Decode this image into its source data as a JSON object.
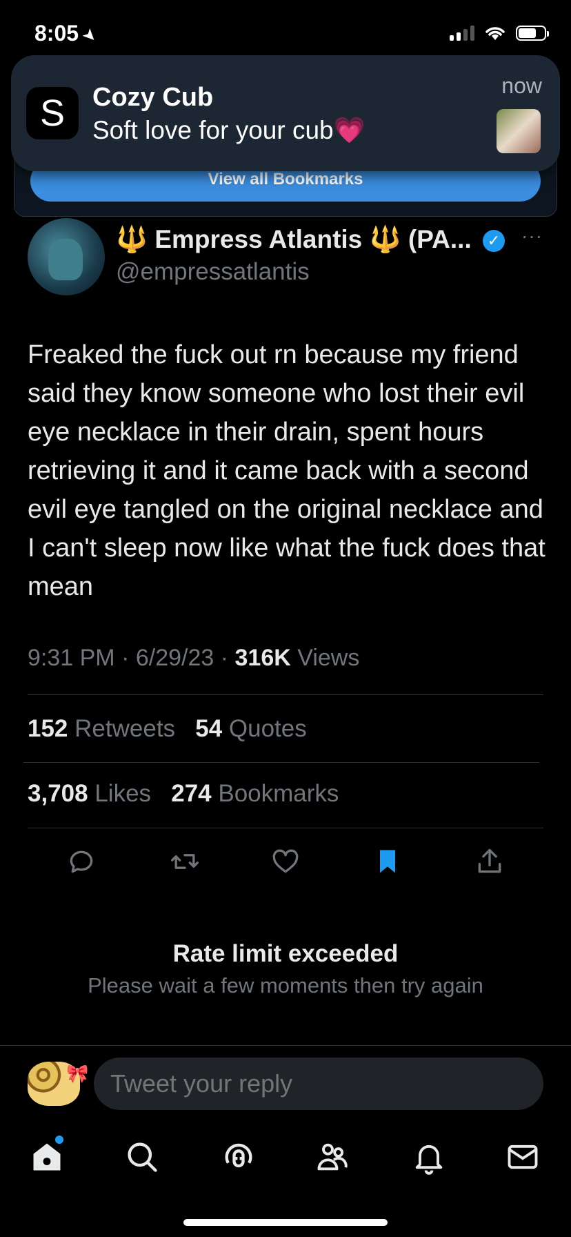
{
  "status_bar": {
    "time": "8:05",
    "location_icon": "location-arrow-icon"
  },
  "notification": {
    "app_icon_letter": "S",
    "title": "Cozy Cub",
    "body": "Soft love for your cub💗",
    "time": "now"
  },
  "bookmark_banner": {
    "button_label": "View all Bookmarks"
  },
  "tweet": {
    "author_name": "Empress Atlantis",
    "name_suffix": "(PA...",
    "trident": "🔱",
    "handle": "@empressatlantis",
    "more": "···",
    "text": "Freaked the fuck out rn because my friend said they know someone who lost their evil eye necklace in their drain, spent hours retrieving it and it came back with a second evil eye tangled on the original necklace and I can't sleep now like what the fuck does that mean",
    "time": "9:31 PM",
    "date": "6/29/23",
    "views_count": "316K",
    "views_label": "Views",
    "stats": {
      "retweets_count": "152",
      "retweets_label": "Retweets",
      "quotes_count": "54",
      "quotes_label": "Quotes",
      "likes_count": "3,708",
      "likes_label": "Likes",
      "bookmarks_count": "274",
      "bookmarks_label": "Bookmarks"
    }
  },
  "colors": {
    "accent": "#1d9bf0",
    "bookmark_active": "#1d9bf0",
    "background": "#000000"
  },
  "rate_limit": {
    "title": "Rate limit exceeded",
    "body": "Please wait a few moments then try again"
  },
  "reply": {
    "placeholder": "Tweet your reply"
  },
  "tab_bar": [
    "home-icon",
    "search-icon",
    "spaces-icon",
    "communities-icon",
    "notifications-icon",
    "messages-icon"
  ]
}
